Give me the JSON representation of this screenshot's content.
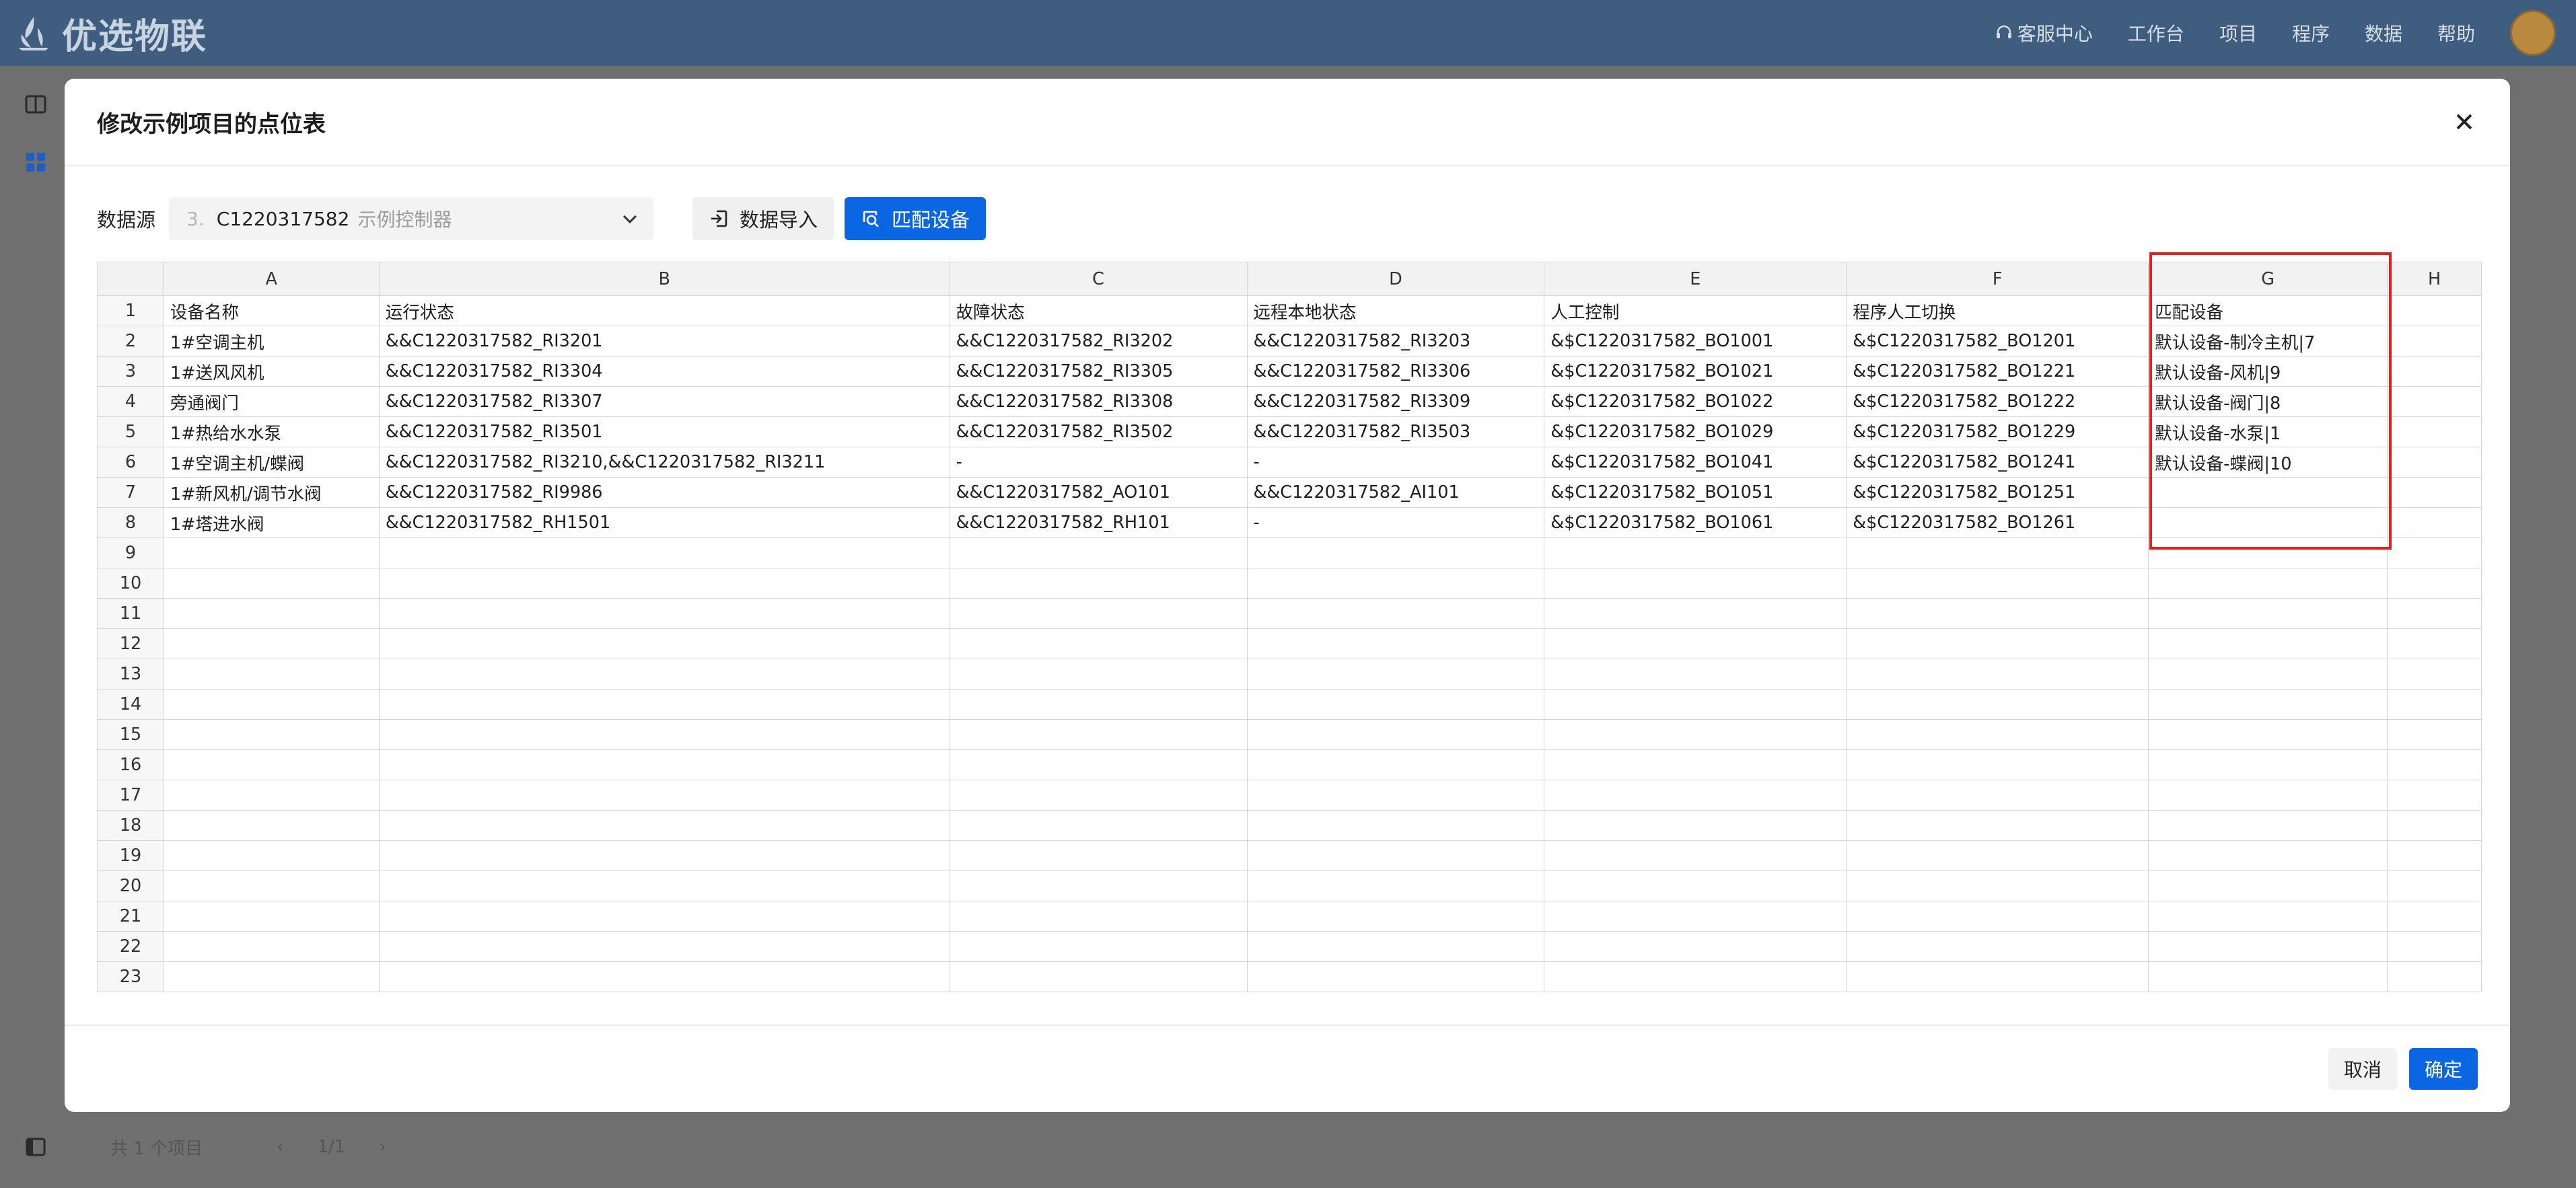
{
  "app": {
    "brand": "优选物联",
    "nav": [
      "客服中心",
      "工作台",
      "项目",
      "程序",
      "数据",
      "帮助"
    ]
  },
  "background": {
    "pager_total": "共 1 个项目",
    "pager_page": "1/1"
  },
  "modal": {
    "title": "修改示例项目的点位表",
    "datasource_label": "数据源",
    "datasource": {
      "index": "3.",
      "code": "C1220317582",
      "name": "示例控制器"
    },
    "import_button": "数据导入",
    "match_button": "匹配设备",
    "cancel_button": "取消",
    "ok_button": "确定"
  },
  "sheet": {
    "columns": [
      "A",
      "B",
      "C",
      "D",
      "E",
      "F",
      "G",
      "H"
    ],
    "rows": [
      [
        "1",
        "设备名称",
        "运行状态",
        "故障状态",
        "远程本地状态",
        "人工控制",
        "程序人工切换",
        "匹配设备",
        ""
      ],
      [
        "2",
        "1#空调主机",
        "&&C1220317582_RI3201",
        "&&C1220317582_RI3202",
        "&&C1220317582_RI3203",
        "&$C1220317582_BO1001",
        "&$C1220317582_BO1201",
        "默认设备-制冷主机|7",
        ""
      ],
      [
        "3",
        "1#送风风机",
        "&&C1220317582_RI3304",
        "&&C1220317582_RI3305",
        "&&C1220317582_RI3306",
        "&$C1220317582_BO1021",
        "&$C1220317582_BO1221",
        "默认设备-风机|9",
        ""
      ],
      [
        "4",
        "旁通阀门",
        "&&C1220317582_RI3307",
        "&&C1220317582_RI3308",
        "&&C1220317582_RI3309",
        "&$C1220317582_BO1022",
        "&$C1220317582_BO1222",
        "默认设备-阀门|8",
        ""
      ],
      [
        "5",
        "1#热给水水泵",
        "&&C1220317582_RI3501",
        "&&C1220317582_RI3502",
        "&&C1220317582_RI3503",
        "&$C1220317582_BO1029",
        "&$C1220317582_BO1229",
        "默认设备-水泵|1",
        ""
      ],
      [
        "6",
        "1#空调主机/蝶阀",
        "&&C1220317582_RI3210,&&C1220317582_RI3211",
        "-",
        "-",
        "&$C1220317582_BO1041",
        "&$C1220317582_BO1241",
        "默认设备-蝶阀|10",
        ""
      ],
      [
        "7",
        "1#新风机/调节水阀",
        "&&C1220317582_RI9986",
        "&&C1220317582_AO101",
        "&&C1220317582_AI101",
        "&$C1220317582_BO1051",
        "&$C1220317582_BO1251",
        "",
        ""
      ],
      [
        "8",
        "1#塔进水阀",
        "&&C1220317582_RH1501",
        "&&C1220317582_RH101",
        "-",
        "&$C1220317582_BO1061",
        "&$C1220317582_BO1261",
        "",
        ""
      ],
      [
        "9",
        "",
        "",
        "",
        "",
        "",
        "",
        "",
        ""
      ],
      [
        "10",
        "",
        "",
        "",
        "",
        "",
        "",
        "",
        ""
      ],
      [
        "11",
        "",
        "",
        "",
        "",
        "",
        "",
        "",
        ""
      ],
      [
        "12",
        "",
        "",
        "",
        "",
        "",
        "",
        "",
        ""
      ],
      [
        "13",
        "",
        "",
        "",
        "",
        "",
        "",
        "",
        ""
      ],
      [
        "14",
        "",
        "",
        "",
        "",
        "",
        "",
        "",
        ""
      ],
      [
        "15",
        "",
        "",
        "",
        "",
        "",
        "",
        "",
        ""
      ],
      [
        "16",
        "",
        "",
        "",
        "",
        "",
        "",
        "",
        ""
      ],
      [
        "17",
        "",
        "",
        "",
        "",
        "",
        "",
        "",
        ""
      ],
      [
        "18",
        "",
        "",
        "",
        "",
        "",
        "",
        "",
        ""
      ],
      [
        "19",
        "",
        "",
        "",
        "",
        "",
        "",
        "",
        ""
      ],
      [
        "20",
        "",
        "",
        "",
        "",
        "",
        "",
        "",
        ""
      ],
      [
        "21",
        "",
        "",
        "",
        "",
        "",
        "",
        "",
        ""
      ],
      [
        "22",
        "",
        "",
        "",
        "",
        "",
        "",
        "",
        ""
      ],
      [
        "23",
        "",
        "",
        "",
        "",
        "",
        "",
        "",
        ""
      ]
    ]
  },
  "colors": {
    "primary": "#0b66e4",
    "highlight": "#e61e1e",
    "topbar": "#3f5d7e"
  }
}
